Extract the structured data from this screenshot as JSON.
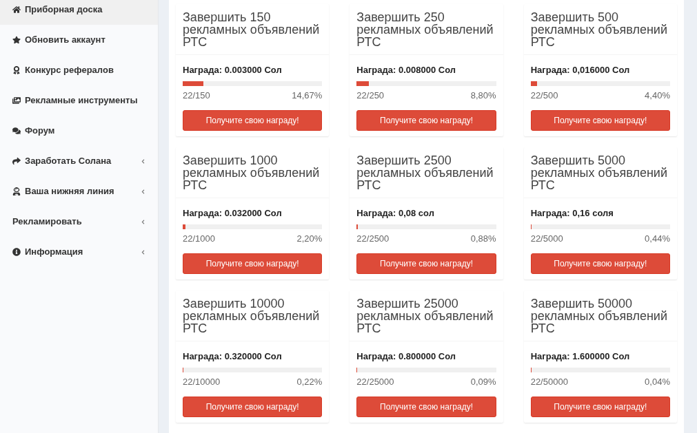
{
  "sidebar": {
    "items": [
      {
        "label": "Приборная доска",
        "selected": true,
        "submenu": false
      },
      {
        "label": "Обновить аккаунт",
        "selected": false,
        "submenu": false
      },
      {
        "label": "Конкурс рефералов",
        "selected": false,
        "submenu": false
      },
      {
        "label": "Рекламные инструменты",
        "selected": false,
        "submenu": false
      },
      {
        "label": "Форум",
        "selected": false,
        "submenu": false
      },
      {
        "label": "Заработать Солана",
        "selected": false,
        "submenu": true
      },
      {
        "label": "Ваша нижняя линия",
        "selected": false,
        "submenu": true
      },
      {
        "label": "Рекламировать",
        "selected": false,
        "submenu": true
      },
      {
        "label": "Информация",
        "selected": false,
        "submenu": true
      }
    ]
  },
  "cards": [
    {
      "title": "Завершить 150 рекламных объявлений РТС",
      "reward": "Награда: 0.003000 Сол",
      "count": "22/150",
      "percent": "14,67%",
      "level": 0.1467,
      "button": "Получите свою награду!"
    },
    {
      "title": "Завершить 250 рекламных объявлений РТС",
      "reward": "Награда: 0.008000 Сол",
      "count": "22/250",
      "percent": "8,80%",
      "level": 0.088,
      "button": "Получите свою награду!"
    },
    {
      "title": "Завершить 500 рекламных объявлений РТС",
      "reward": "Награда: 0,016000 Сол",
      "count": "22/500",
      "percent": "4,40%",
      "level": 0.044,
      "button": "Получите свою награду!"
    },
    {
      "title": "Завершить 1000 рекламных объявлений РТС",
      "reward": "Награда: 0.032000 Сол",
      "count": "22/1000",
      "percent": "2,20%",
      "level": 0.022,
      "button": "Получите свою награду!"
    },
    {
      "title": "Завершить 2500 рекламных объявлений РТС",
      "reward": "Награда: 0,08 сол",
      "count": "22/2500",
      "percent": "0,88%",
      "level": 0.0088,
      "button": "Получите свою награду!"
    },
    {
      "title": "Завершить 5000 рекламных объявлений РТС",
      "reward": "Награда: 0,16 соля",
      "count": "22/5000",
      "percent": "0,44%",
      "level": 0.0044,
      "button": "Получите свою награду!"
    },
    {
      "title": "Завершить 10000 рекламных объявлений РТС",
      "reward": "Награда: 0.320000 Сол",
      "count": "22/10000",
      "percent": "0,22%",
      "level": 0.0022,
      "button": "Получите свою награду!"
    },
    {
      "title": "Завершить 25000 рекламных объявлений РТС",
      "reward": "Награда: 0.800000 Сол",
      "count": "22/25000",
      "percent": "0,09%",
      "level": 0.0009,
      "button": "Получите свою награду!"
    },
    {
      "title": "Завершить 50000 рекламных объявлений РТС",
      "reward": "Награда: 1.600000 Сол",
      "count": "22/50000",
      "percent": "0,04%",
      "level": 0.0004,
      "button": "Получите свою награду!"
    }
  ]
}
